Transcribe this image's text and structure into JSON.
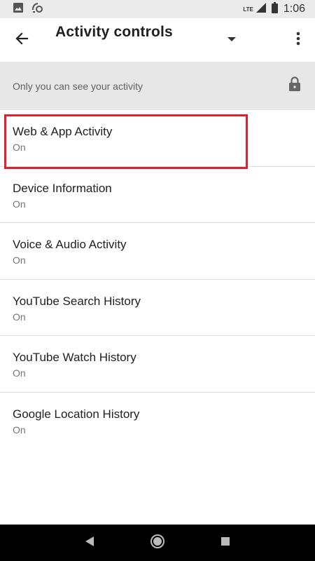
{
  "status_bar": {
    "network": "LTE",
    "time": "1:06",
    "icons": [
      "image-icon",
      "cast-icon",
      "signal-icon",
      "battery-icon"
    ]
  },
  "app_bar": {
    "title": "Activity controls",
    "icons": [
      "back-arrow-icon",
      "dropdown-icon",
      "more-vert-icon"
    ]
  },
  "privacy_banner": {
    "text": "Only you can see your activity",
    "icon": "lock-icon"
  },
  "activities": [
    {
      "title": "Web & App Activity",
      "status": "On"
    },
    {
      "title": "Device Information",
      "status": "On"
    },
    {
      "title": "Voice & Audio Activity",
      "status": "On"
    },
    {
      "title": "YouTube Search History",
      "status": "On"
    },
    {
      "title": "YouTube Watch History",
      "status": "On"
    },
    {
      "title": "Google Location History",
      "status": "On"
    }
  ],
  "highlighted_item": "Voice & Audio Activity",
  "colors": {
    "highlight": "#e0202e",
    "banner_bg": "#e7e7e7",
    "status_bar_bg": "#ebebeb",
    "nav_bar_bg": "#000000"
  },
  "nav_bar": {
    "icons": [
      "back-triangle-icon",
      "home-circle-icon",
      "recents-square-icon"
    ]
  }
}
